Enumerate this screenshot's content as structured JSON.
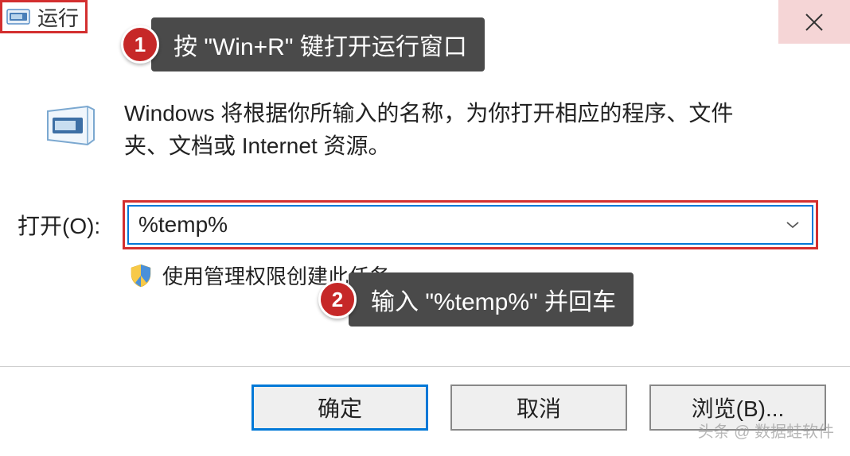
{
  "window": {
    "title": "运行"
  },
  "annotations": {
    "step1": {
      "number": "1",
      "text": "按 \"Win+R\" 键打开运行窗口"
    },
    "step2": {
      "number": "2",
      "text": "输入 \"%temp%\" 并回车"
    }
  },
  "description": "Windows 将根据你所输入的名称，为你打开相应的程序、文件夹、文档或 Internet 资源。",
  "open_label": "打开(O):",
  "input_value": "%temp%",
  "admin_text": "使用管理权限创建此任务。",
  "buttons": {
    "ok": "确定",
    "cancel": "取消",
    "browse": "浏览(B)..."
  },
  "watermark": "头条 @ 数据蛙软件"
}
